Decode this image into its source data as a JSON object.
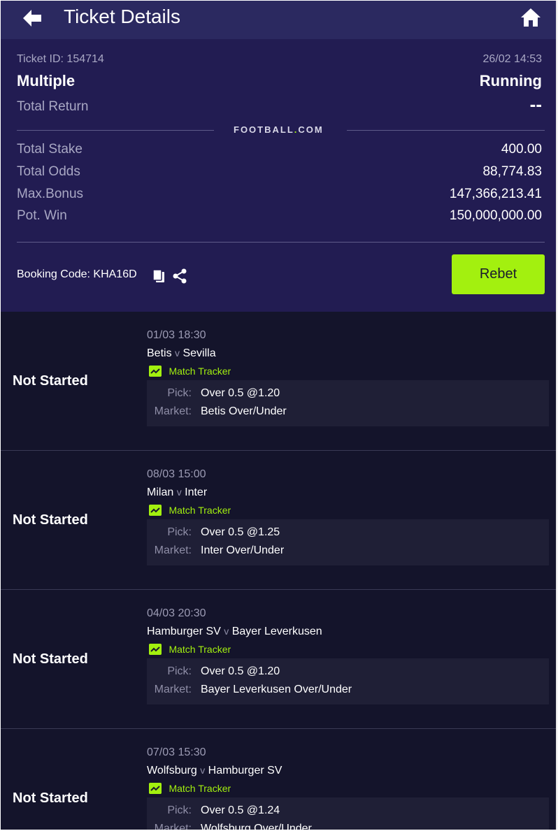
{
  "header": {
    "title": "Ticket Details",
    "back_icon": "arrow-left-icon",
    "home_icon": "home-icon"
  },
  "ticket": {
    "id_label": "Ticket ID: 154714",
    "datetime": "26/02 14:53",
    "type": "Multiple",
    "status": "Running",
    "total_return_label": "Total Return",
    "total_return_value": "--",
    "brand_prefix": "FOOTBALL",
    "brand_dot": ".",
    "brand_suffix": "COM",
    "rows": [
      {
        "label": "Total Stake",
        "value": "400.00"
      },
      {
        "label": "Total Odds",
        "value": "88,774.83"
      },
      {
        "label": "Max.Bonus",
        "value": "147,366,213.41"
      },
      {
        "label": "Pot. Win",
        "value": "150,000,000.00"
      }
    ],
    "booking_code_label": "Booking Code: KHA16D",
    "copy_icon": "copy-icon",
    "share_icon": "share-icon",
    "rebet_label": "Rebet"
  },
  "colors": {
    "header_bg": "#2b2960",
    "panel_bg": "#221c52",
    "list_bg": "#14142b",
    "accent": "#a3f00f"
  },
  "selections": [
    {
      "status": "Not Started",
      "date": "01/03 18:30",
      "home": "Betis",
      "vs": "v",
      "away": "Sevilla",
      "tracker": "Match Tracker",
      "pick_label": "Pick:",
      "pick": "Over 0.5 @1.20",
      "market_label": "Market:",
      "market": "Betis Over/Under"
    },
    {
      "status": "Not Started",
      "date": "08/03 15:00",
      "home": "Milan",
      "vs": "v",
      "away": "Inter",
      "tracker": "Match Tracker",
      "pick_label": "Pick:",
      "pick": "Over 0.5 @1.25",
      "market_label": "Market:",
      "market": "Inter Over/Under"
    },
    {
      "status": "Not Started",
      "date": "04/03 20:30",
      "home": "Hamburger SV",
      "vs": "v",
      "away": "Bayer Leverkusen",
      "tracker": "Match Tracker",
      "pick_label": "Pick:",
      "pick": "Over 0.5 @1.20",
      "market_label": "Market:",
      "market": "Bayer Leverkusen Over/Under"
    },
    {
      "status": "Not Started",
      "date": "07/03 15:30",
      "home": "Wolfsburg",
      "vs": "v",
      "away": "Hamburger SV",
      "tracker": "Match Tracker",
      "pick_label": "Pick:",
      "pick": "Over 0.5 @1.24",
      "market_label": "Market:",
      "market": "Wolfsburg Over/Under"
    }
  ]
}
